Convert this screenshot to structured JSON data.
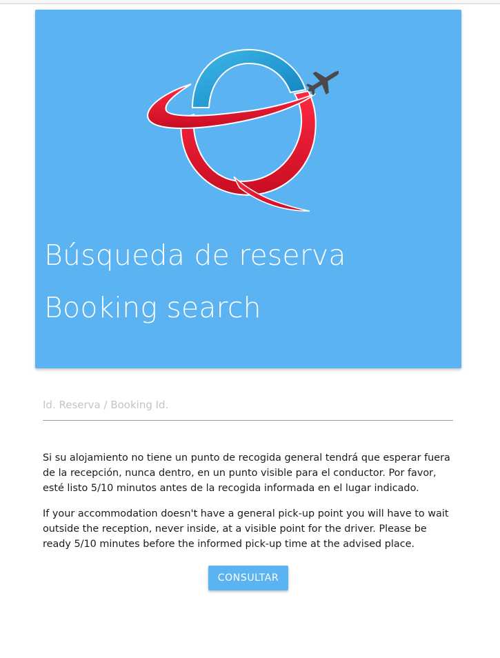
{
  "header": {
    "title_es": "Búsqueda de reserva",
    "title_en": "Booking search"
  },
  "logo": {
    "icon": "airplane-q-logo",
    "colors": {
      "arc_blue": "#1b9bd6",
      "swoosh_red": "#e8112d",
      "plane": "#4a4a4a"
    }
  },
  "form": {
    "booking_id_placeholder": "Id. Reserva / Booking Id.",
    "booking_id_value": ""
  },
  "notices": {
    "es": "Si su alojamiento no tiene un punto de recogida general tendrá que esperar fuera de la recepción, nunca dentro, en un punto visible para el conductor. Por favor, esté listo 5/10 minutos antes de la recogida informada en el lugar indicado.",
    "en": "If your accommodation doesn't have a general pick-up point you will have to wait outside the reception, never inside, at a visible point for the driver. Please be ready 5/10 minutes before the informed pick-up time at the advised place."
  },
  "actions": {
    "consult_label": "CONSULTAR"
  },
  "theme": {
    "primary": "#5bb3f2"
  }
}
